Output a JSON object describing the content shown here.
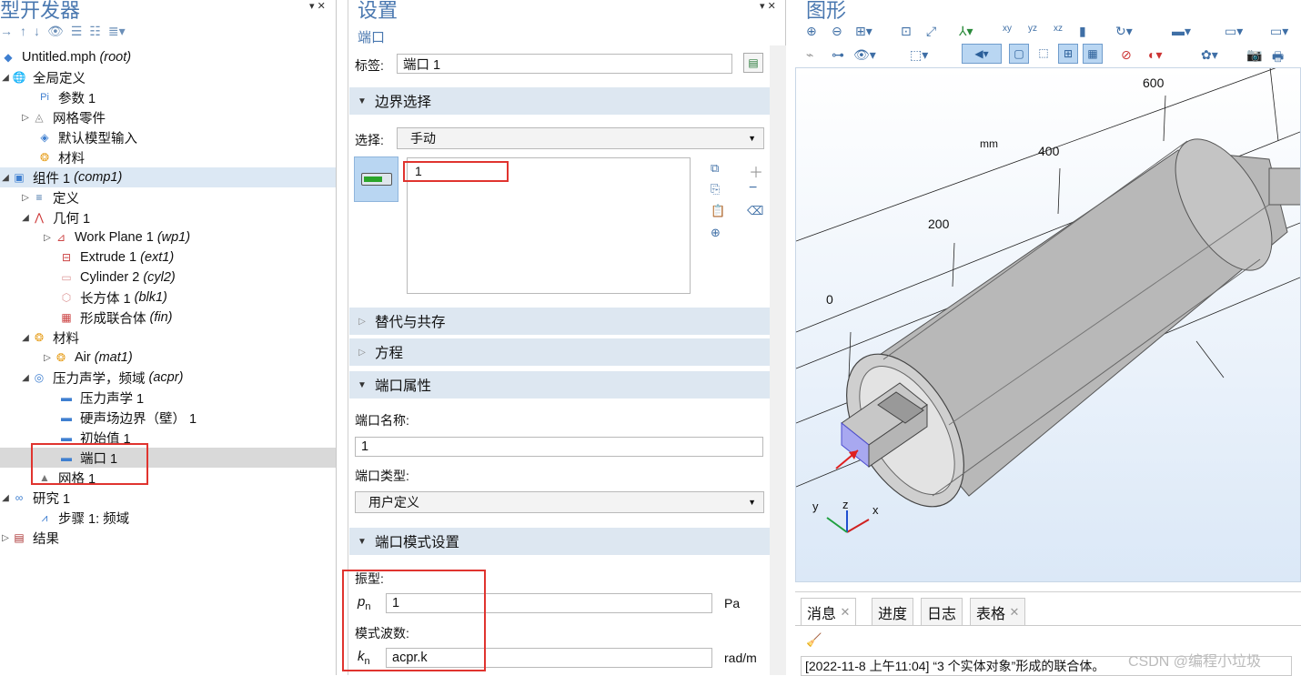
{
  "model_builder": {
    "title": "型开发器",
    "tree": [
      {
        "label": "Untitled.mph",
        "tag": "(root)"
      },
      {
        "label": "全局定义"
      },
      {
        "label": "参数 1"
      },
      {
        "label": "网格零件"
      },
      {
        "label": "默认模型输入"
      },
      {
        "label": "材料"
      },
      {
        "label": "组件 1",
        "tag": "(comp1)"
      },
      {
        "label": "定义"
      },
      {
        "label": "几何 1"
      },
      {
        "label": "Work Plane 1",
        "tag": "(wp1)"
      },
      {
        "label": "Extrude 1",
        "tag": "(ext1)"
      },
      {
        "label": "Cylinder 2",
        "tag": "(cyl2)"
      },
      {
        "label": "长方体 1",
        "tag": "(blk1)"
      },
      {
        "label": "形成联合体",
        "tag": "(fin)"
      },
      {
        "label": "材料"
      },
      {
        "label": "Air",
        "tag": "(mat1)"
      },
      {
        "label": "压力声学，频域",
        "tag": "(acpr)"
      },
      {
        "label": "压力声学 1"
      },
      {
        "label": "硬声场边界（壁） 1"
      },
      {
        "label": "初始值 1"
      },
      {
        "label": "端口 1"
      },
      {
        "label": "网格 1"
      },
      {
        "label": "研究 1"
      },
      {
        "label": "步骤 1: 频域"
      },
      {
        "label": "结果"
      }
    ]
  },
  "settings": {
    "title": "设置",
    "subtitle": "端口",
    "label_caption": "标签:",
    "label_value": "端口 1",
    "sections": {
      "boundary": "边界选择",
      "override": "替代与共存",
      "equation": "方程",
      "port_props": "端口属性",
      "port_mode": "端口模式设置"
    },
    "selection_caption": "选择:",
    "selection_value": "手动",
    "selection_items": [
      "1"
    ],
    "port_name_caption": "端口名称:",
    "port_name_value": "1",
    "port_type_caption": "端口类型:",
    "port_type_value": "用户定义",
    "amplitude_caption": "振型:",
    "pn_symbol": "p",
    "pn_sub": "n",
    "pn_value": "1",
    "pn_unit": "Pa",
    "wavenumber_caption": "模式波数:",
    "kn_symbol": "k",
    "kn_sub": "n",
    "kn_value": "acpr.k",
    "kn_unit": "rad/m"
  },
  "graphics": {
    "title": "图形",
    "unit": "mm",
    "axis_ticks": [
      "600",
      "400",
      "200",
      "0"
    ],
    "triad": {
      "x": "x",
      "y": "y",
      "z": "z"
    }
  },
  "messages": {
    "tabs": [
      "消息",
      "进度",
      "日志",
      "表格"
    ],
    "log_line": "[2022-11-8 上午11:04] “3 个实体对象”形成的联合体。"
  },
  "watermark": "CSDN @编程小垃圾",
  "colors": {
    "accent": "#4a78b0",
    "highlight": "#e0342f",
    "section_bg": "#dde7f1",
    "selected_row": "#d9d9d9"
  }
}
